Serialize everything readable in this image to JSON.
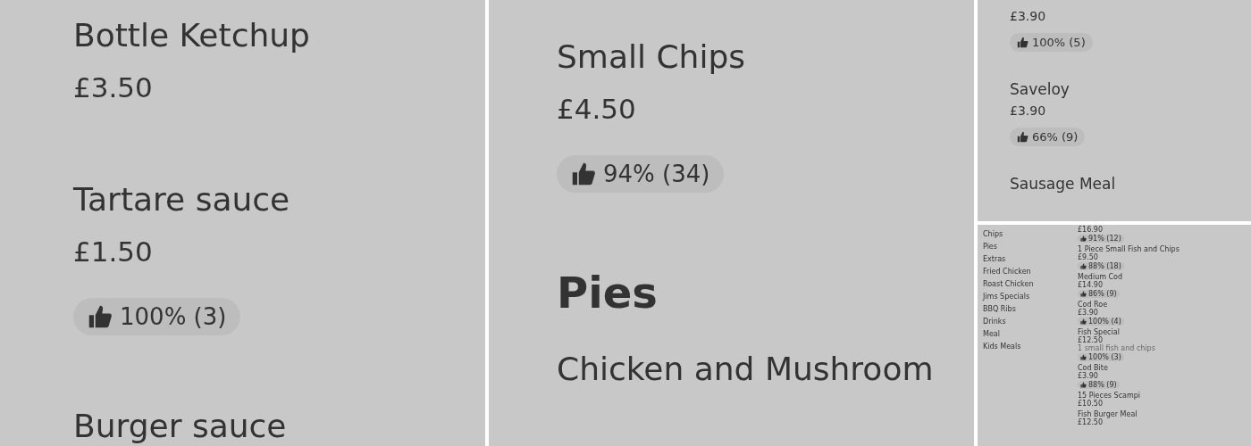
{
  "panels": [
    {
      "kind": "large",
      "items": [
        {
          "kind": "item",
          "name": "Bottle Ketchup",
          "price": "£3.50"
        },
        {
          "kind": "item",
          "name": "Tartare sauce",
          "price": "£1.50",
          "rating": "100% (3)"
        },
        {
          "kind": "item",
          "name": "Burger sauce"
        }
      ]
    },
    {
      "kind": "large",
      "items": [
        {
          "kind": "item",
          "name": "Small Chips",
          "price": "£4.50",
          "rating": "94% (34)"
        },
        {
          "kind": "heading",
          "name": "Pies"
        },
        {
          "kind": "item",
          "name": "Chicken and Mushroom"
        }
      ]
    },
    {
      "kind": "medium",
      "items": [
        {
          "kind": "item",
          "price": "£3.90",
          "rating": "100% (5)"
        },
        {
          "kind": "item",
          "name": "Saveloy",
          "price": "£3.90",
          "rating": "66% (9)"
        },
        {
          "kind": "item",
          "name": "Sausage Meal"
        }
      ]
    },
    {
      "kind": "overview",
      "categories": [
        "Chips",
        "Pies",
        "Extras",
        "Fried Chicken",
        "Roast Chicken",
        "Jims Specials",
        "BBQ Ribs",
        "Drinks",
        "Meal",
        "Kids Meals"
      ],
      "items": [
        {
          "kind": "item",
          "price": "£16.90",
          "rating": "91% (12)"
        },
        {
          "kind": "item",
          "name": "1 Piece Small Fish and Chips",
          "price": "£9.50",
          "rating": "88% (18)"
        },
        {
          "kind": "item",
          "name": "Medium Cod",
          "price": "£14.90",
          "rating": "86% (9)"
        },
        {
          "kind": "item",
          "name": "Cod Roe",
          "price": "£3.90",
          "rating": "100% (4)"
        },
        {
          "kind": "item",
          "name": "Fish Special",
          "price": "£12.50",
          "description": "1 small fish and chips",
          "rating": "100% (3)"
        },
        {
          "kind": "item",
          "name": "Cod Bite",
          "price": "£3.90",
          "rating": "88% (9)"
        },
        {
          "kind": "item",
          "name": "15 Pieces Scampi",
          "price": "£10.50"
        },
        {
          "kind": "item",
          "name": "Fish Burger Meal",
          "price": "£12.50"
        }
      ]
    }
  ]
}
